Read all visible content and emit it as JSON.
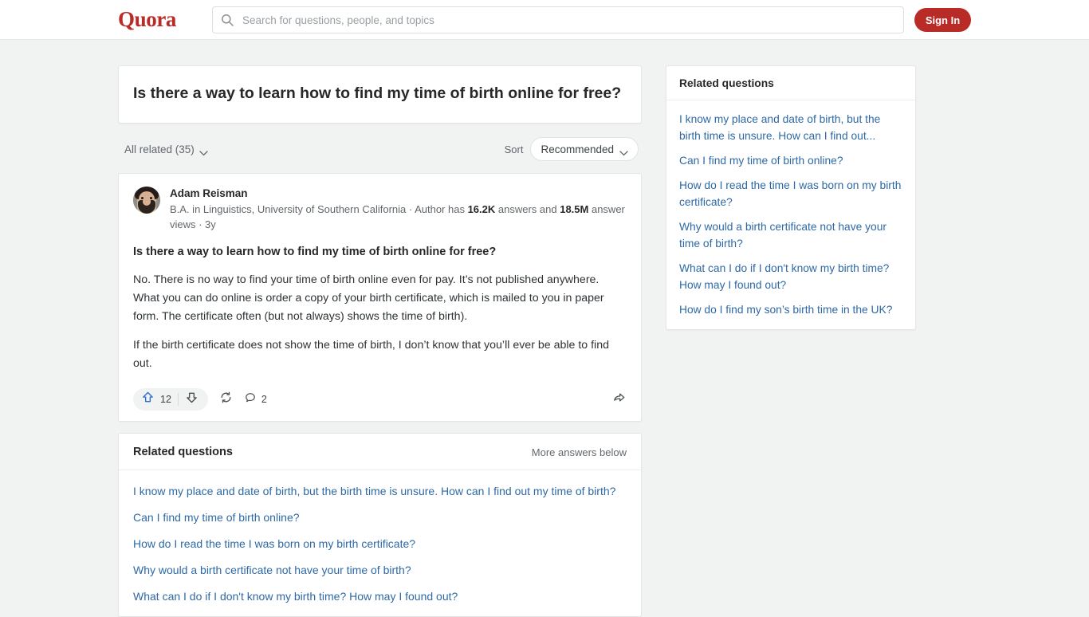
{
  "header": {
    "logo": "Quora",
    "search_placeholder": "Search for questions, people, and topics",
    "search_value": "",
    "signin_label": "Sign In"
  },
  "question": {
    "title": "Is there a way to learn how to find my time of birth online for free?"
  },
  "filters": {
    "all_related_label": "All related (35)",
    "sort_label": "Sort",
    "sort_value": "Recommended"
  },
  "answer": {
    "author_name": "Adam Reisman",
    "credential_prefix": "B.A. in Linguistics, University of Southern California · Author has ",
    "answers_count": "16.2K",
    "credential_mid": " answers and ",
    "views_count": "18.5M",
    "credential_suffix": " answer views · 3y",
    "question_restated": "Is there a way to learn how to find my time of birth online for free?",
    "paragraph_1": "No. There is no way to find your time of birth online even for pay. It’s not published anywhere. What you can do online is order a copy of your birth certificate, which is mailed to you in paper form. The certificate often (but not always) shows the time of birth).",
    "paragraph_2": "If the birth certificate does not show the time of birth, I don’t know that you’ll ever be able to find out.",
    "upvote_count": "12",
    "comment_count": "2"
  },
  "related_main": {
    "title": "Related questions",
    "more_label": "More answers below",
    "items": [
      "I know my place and date of birth, but the birth time is unsure. How can I find out my time of birth?",
      "Can I find my time of birth online?",
      "How do I read the time I was born on my birth certificate?",
      "Why would a birth certificate not have your time of birth?",
      "What can I do if I don't know my birth time? How may I found out?"
    ]
  },
  "sidebar": {
    "title": "Related questions",
    "items": [
      "I know my place and date of birth, but the birth time is unsure. How can I find out...",
      "Can I find my time of birth online?",
      "How do I read the time I was born on my birth certificate?",
      "Why would a birth certificate not have your time of birth?",
      "What can I do if I don't know my birth time? How may I found out?",
      "How do I find my son’s birth time in the UK?"
    ]
  },
  "colors": {
    "brand_red": "#b92b27",
    "link_blue": "#2e69a5",
    "upvote_blue": "#2b6dd1",
    "page_bg": "#f1f2f2"
  }
}
